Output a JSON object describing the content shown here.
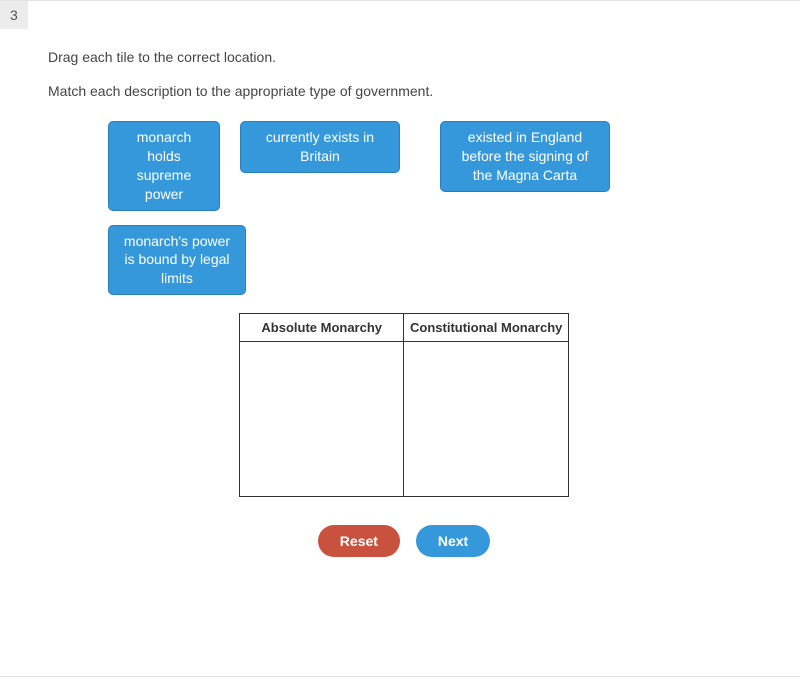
{
  "question_number": "3",
  "instruction_1": "Drag each tile to the correct location.",
  "instruction_2": "Match each description to the appropriate type of government.",
  "tiles": [
    "monarch holds supreme power",
    "currently exists in Britain",
    "existed in England before the signing of the Magna Carta",
    "monarch's power is bound by legal limits"
  ],
  "table": {
    "col1_header": "Absolute Monarchy",
    "col2_header": "Constitutional Monarchy"
  },
  "buttons": {
    "reset": "Reset",
    "next": "Next"
  }
}
